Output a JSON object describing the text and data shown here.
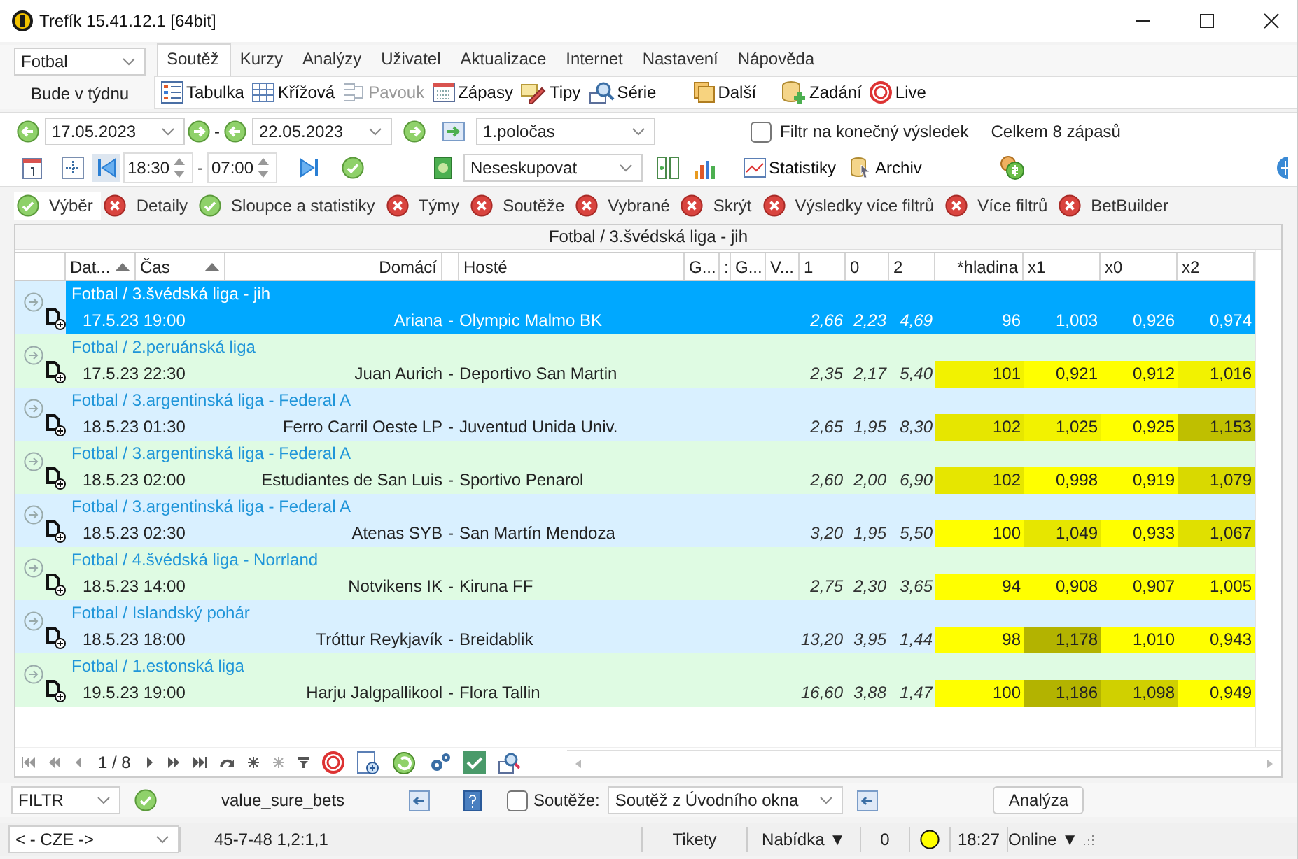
{
  "window": {
    "title": "Trefík 15.41.12.1 [64bit]"
  },
  "sport_select": {
    "value": "Fotbal"
  },
  "period_label": "Bude v týdnu",
  "menu": [
    {
      "label": "Soutěž",
      "selected": true
    },
    {
      "label": "Kurzy",
      "selected": false
    },
    {
      "label": "Analýzy",
      "selected": false
    },
    {
      "label": "Uživatel",
      "selected": false
    },
    {
      "label": "Aktualizace",
      "selected": false
    },
    {
      "label": "Internet",
      "selected": false
    },
    {
      "label": "Nastavení",
      "selected": false
    },
    {
      "label": "Nápověda",
      "selected": false
    }
  ],
  "toolbar": [
    {
      "label": "Tabulka",
      "kind": "table",
      "disabled": false
    },
    {
      "label": "Křížová",
      "kind": "grid",
      "disabled": false
    },
    {
      "label": "Pavouk",
      "kind": "bracket",
      "disabled": true
    },
    {
      "label": "Zápasy",
      "kind": "calendar",
      "disabled": false
    },
    {
      "label": "Tipy",
      "kind": "tips",
      "disabled": false
    },
    {
      "label": "Série",
      "kind": "series",
      "disabled": false
    },
    {
      "label": "Další",
      "kind": "folders",
      "disabled": false
    },
    {
      "label": "Zadání",
      "kind": "add",
      "disabled": false
    },
    {
      "label": "Live",
      "kind": "live",
      "disabled": false
    }
  ],
  "filters": {
    "date_from": "17.05.2023",
    "date_separator": "-",
    "date_to": "22.05.2023",
    "period": "1.poločas",
    "final_result_filter": {
      "label": "Filtr na konečný výsledek",
      "checked": false
    },
    "total": "Celkem 8 zápasů",
    "time_from": "18:30",
    "time_separator": "-",
    "time_to": "07:00",
    "grouping": "Neseskupovat",
    "statistics_button": "Statistiky",
    "archive_button": "Archiv"
  },
  "filter_tabs": [
    {
      "label": "Výběr",
      "on": true,
      "selected": true
    },
    {
      "label": "Detaily",
      "on": false,
      "selected": false
    },
    {
      "label": "Sloupce a statistiky",
      "on": true,
      "selected": false
    },
    {
      "label": "Týmy",
      "on": false,
      "selected": false
    },
    {
      "label": "Soutěže",
      "on": false,
      "selected": false
    },
    {
      "label": "Vybrané",
      "on": false,
      "selected": false
    },
    {
      "label": "Skrýt",
      "on": false,
      "selected": false
    },
    {
      "label": "Výsledky více filtrů",
      "on": false,
      "selected": false
    },
    {
      "label": "Více filtrů",
      "on": false,
      "selected": false
    },
    {
      "label": "BetBuilder",
      "on": false,
      "selected": false
    }
  ],
  "grid": {
    "title": "Fotbal / 3.švédská liga - jih",
    "columns": [
      {
        "label": "Dat...",
        "sorted": true
      },
      {
        "label": "Čas",
        "sorted": true
      },
      {
        "label": "Domácí",
        "sorted": false
      },
      {
        "label": "Hosté",
        "sorted": false
      },
      {
        "label": "G...",
        "sorted": false
      },
      {
        "label": ":",
        "sorted": false
      },
      {
        "label": "G...",
        "sorted": false
      },
      {
        "label": "V...",
        "sorted": false
      },
      {
        "label": "1",
        "sorted": false
      },
      {
        "label": "0",
        "sorted": false
      },
      {
        "label": "2",
        "sorted": false
      },
      {
        "label": "*hladina",
        "sorted": false
      },
      {
        "label": "x1",
        "sorted": false
      },
      {
        "label": "x0",
        "sorted": false
      },
      {
        "label": "x2",
        "sorted": false
      }
    ],
    "rows": [
      {
        "league": "Fotbal / 3.švédská liga - jih",
        "datetime": "17.5.23 19:00",
        "home": "Ariana",
        "separator": "-",
        "away": "Olympic Malmo BK",
        "odds": [
          "2,66",
          "2,23",
          "4,69"
        ],
        "values": [
          {
            "text": "96"
          },
          {
            "text": "1,003"
          },
          {
            "text": "0,926"
          },
          {
            "text": "0,974"
          }
        ],
        "selected": true
      },
      {
        "league": "Fotbal / 2.peruánská liga",
        "datetime": "17.5.23 22:30",
        "home": "Juan Aurich",
        "separator": "-",
        "away": "Deportivo San Martin",
        "odds": [
          "2,35",
          "2,17",
          "5,40"
        ],
        "values": [
          {
            "text": "101",
            "color": "#f2f200"
          },
          {
            "text": "0,921",
            "color": "#ffff00"
          },
          {
            "text": "0,912",
            "color": "#ffff00"
          },
          {
            "text": "1,016",
            "color": "#f2f200"
          }
        ],
        "selected": false
      },
      {
        "league": "Fotbal / 3.argentinská liga - Federal A",
        "datetime": "18.5.23 01:30",
        "home": "Ferro Carril Oeste LP",
        "separator": "-",
        "away": "Juventud Unida Univ.",
        "odds": [
          "2,65",
          "1,95",
          "8,30"
        ],
        "values": [
          {
            "text": "102",
            "color": "#e6e600"
          },
          {
            "text": "1,025",
            "color": "#f2f200"
          },
          {
            "text": "0,925",
            "color": "#ffff00"
          },
          {
            "text": "1,153",
            "color": "#bfbf00"
          }
        ],
        "selected": false
      },
      {
        "league": "Fotbal / 3.argentinská liga - Federal A",
        "datetime": "18.5.23 02:00",
        "home": "Estudiantes de San Luis",
        "separator": "-",
        "away": "Sportivo Penarol",
        "odds": [
          "2,60",
          "2,00",
          "6,90"
        ],
        "values": [
          {
            "text": "102",
            "color": "#e6e600"
          },
          {
            "text": "0,998",
            "color": "#ffff00"
          },
          {
            "text": "0,919",
            "color": "#ffff00"
          },
          {
            "text": "1,079",
            "color": "#d9d900"
          }
        ],
        "selected": false
      },
      {
        "league": "Fotbal / 3.argentinská liga - Federal A",
        "datetime": "18.5.23 02:30",
        "home": "Atenas SYB",
        "separator": "-",
        "away": "San Martín Mendoza",
        "odds": [
          "3,20",
          "1,95",
          "5,50"
        ],
        "values": [
          {
            "text": "100",
            "color": "#ffff00"
          },
          {
            "text": "1,049",
            "color": "#e6e600"
          },
          {
            "text": "0,933",
            "color": "#ffff00"
          },
          {
            "text": "1,067",
            "color": "#e0e000"
          }
        ],
        "selected": false
      },
      {
        "league": "Fotbal / 4.švédská liga - Norrland",
        "datetime": "18.5.23 14:00",
        "home": "Notvikens IK",
        "separator": "-",
        "away": "Kiruna FF",
        "odds": [
          "2,75",
          "2,30",
          "3,65"
        ],
        "values": [
          {
            "text": "94",
            "color": "#ffff00"
          },
          {
            "text": "0,908",
            "color": "#ffff00"
          },
          {
            "text": "0,907",
            "color": "#ffff00"
          },
          {
            "text": "1,005",
            "color": "#ffff00"
          }
        ],
        "selected": false
      },
      {
        "league": "Fotbal / Islandský pohár",
        "datetime": "18.5.23 18:00",
        "home": "Tróttur Reykjavík",
        "separator": "-",
        "away": "Breidablik",
        "odds": [
          "13,20",
          "3,95",
          "1,44"
        ],
        "values": [
          {
            "text": "98",
            "color": "#ffff00"
          },
          {
            "text": "1,178",
            "color": "#b3b300"
          },
          {
            "text": "1,010",
            "color": "#ffff00"
          },
          {
            "text": "0,943",
            "color": "#ffff00"
          }
        ],
        "selected": false
      },
      {
        "league": "Fotbal / 1.estonská liga",
        "datetime": "19.5.23 19:00",
        "home": "Harju Jalgpallikool",
        "separator": "-",
        "away": "Flora Tallin",
        "odds": [
          "16,60",
          "3,88",
          "1,47"
        ],
        "values": [
          {
            "text": "100",
            "color": "#ffff00"
          },
          {
            "text": "1,186",
            "color": "#b3b300"
          },
          {
            "text": "1,098",
            "color": "#d0d000"
          },
          {
            "text": "0,949",
            "color": "#ffff00"
          }
        ],
        "selected": false
      }
    ]
  },
  "pager": {
    "position": "1 / 8"
  },
  "bottom": {
    "filter_select": "FILTR",
    "filter_name": "value_sure_bets",
    "competitions": {
      "label": "Soutěže:",
      "checked": false
    },
    "competition_select": "Soutěž z Úvodního okna",
    "analyze_button": "Analýza"
  },
  "status_bar": {
    "country": "< - CZE ->",
    "record": "45-7-48  1,2:1,1",
    "tickets": "Tikety",
    "offer": "Nabídka ▼",
    "count": "0",
    "time": "18:27",
    "connection": "Online ▼"
  }
}
